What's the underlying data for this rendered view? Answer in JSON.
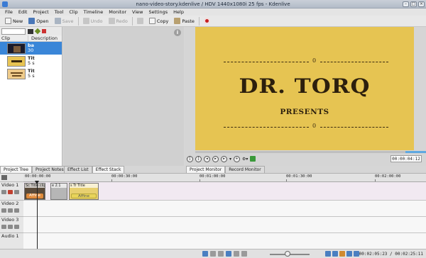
{
  "window": {
    "title": "nano-video-story.kdenlive / HDV 1440x1080i 25 fps - Kdenlive"
  },
  "menu": [
    "File",
    "Edit",
    "Project",
    "Tool",
    "Clip",
    "Timeline",
    "Monitor",
    "View",
    "Settings",
    "Help"
  ],
  "toolbar": {
    "new": "New",
    "open": "Open",
    "save": "Save",
    "undo": "Undo",
    "redo": "Redo",
    "copy": "Copy",
    "paste": "Paste"
  },
  "clips": {
    "headers": {
      "clip": "Clip",
      "description": "Description"
    },
    "items": [
      {
        "name": "ba",
        "meta": "30"
      },
      {
        "name": "Tit",
        "meta": "5 s"
      },
      {
        "name": "Tit",
        "meta": "5 s"
      }
    ]
  },
  "left_tabs": [
    "Project Tree",
    "Project Notes"
  ],
  "effect_tabs": [
    "Effect List",
    "Effect Stack"
  ],
  "monitor": {
    "title_text": "DR. TORQ",
    "subtitle_text": "PRESENTS",
    "ring_symbol": "0",
    "timecode": "00:00:04:12",
    "tabs": [
      "Project Monitor",
      "Record Monitor"
    ],
    "seek_progress": 0.91
  },
  "timeline": {
    "ruler": [
      "00:00:00:00",
      "00:00:30:00",
      "00:01:00:00",
      "00:01:30:00",
      "00:02:00:00"
    ],
    "tracks": [
      {
        "name": "Video 1",
        "clips": [
          {
            "label": "Sc Title clip",
            "effect": "Affine"
          },
          {
            "label": "e 2.1",
            "effect": ""
          },
          {
            "label": "s Tr Title",
            "effect": "Affine"
          }
        ]
      },
      {
        "name": "Video 2",
        "clips": []
      },
      {
        "name": "Video 3",
        "clips": []
      },
      {
        "name": "Audio 1",
        "clips": []
      }
    ]
  },
  "status": {
    "time": "00:02:05:23 / 00:02:25:11"
  },
  "colors": {
    "accent": "#3a86d8",
    "title_bg": "#e6c452",
    "affine_orange": "#e08a3c",
    "affine_yellow": "#e8d45a"
  }
}
